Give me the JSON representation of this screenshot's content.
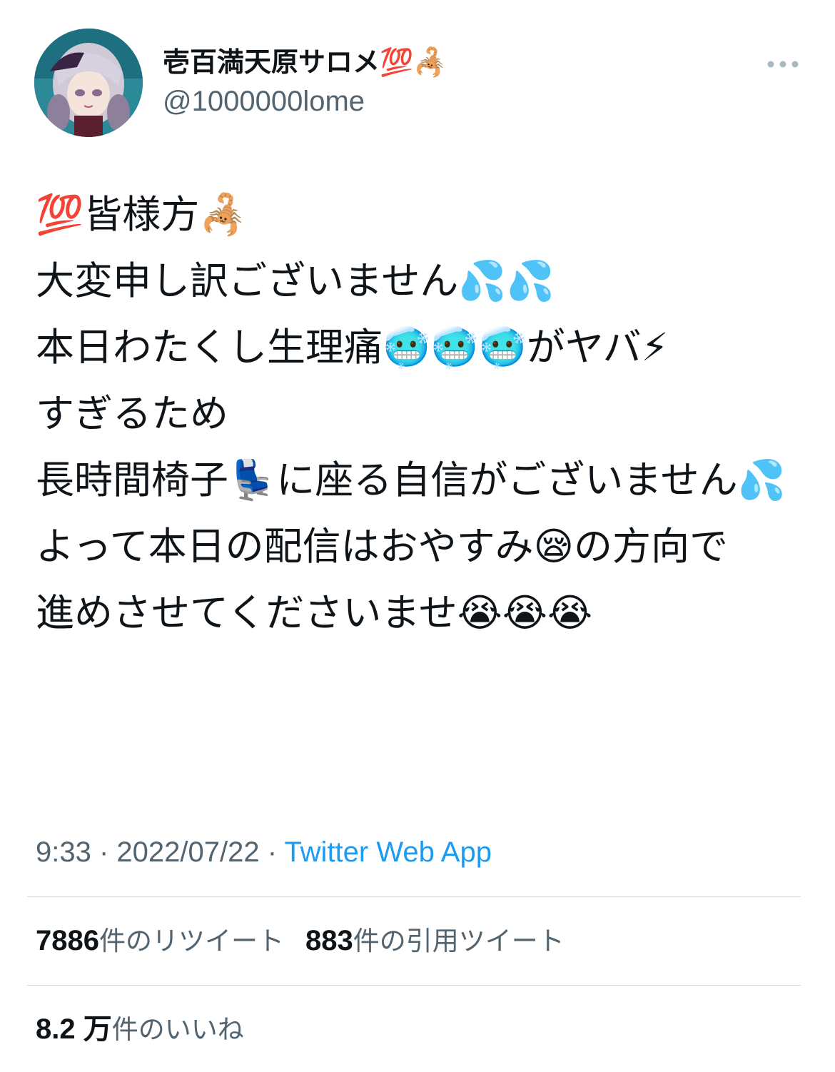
{
  "tweet": {
    "author": {
      "display_name": "壱百満天原サロメ💯🦂",
      "handle": "@1000000lome"
    },
    "text": "💯皆様方🦂\n大変申し訳ございません💦💦\n本日わたくし生理痛🥶🥶🥶がヤバ⚡\nすぎるため\n長時間椅子💺に座る自信がございません💦\nよって本日の配信はおやすみ😪の方向で\n進めさせてくださいませ😭😭😭",
    "time": "9:33",
    "date": "2022/07/22",
    "separator": " · ",
    "source": "Twitter Web App"
  },
  "stats": {
    "retweets_count": "7886",
    "retweets_label": "件のリツイート",
    "quotes_count": "883",
    "quotes_label": "件の引用ツイート",
    "likes_count": "8.2 万",
    "likes_label": "件のいいね"
  },
  "icons": {
    "more": "more-horizontal-icon",
    "avatar": "avatar-image"
  },
  "colors": {
    "text_primary": "#0f1419",
    "text_secondary": "#536471",
    "link": "#1d9bf0",
    "divider": "#cfd9de"
  }
}
